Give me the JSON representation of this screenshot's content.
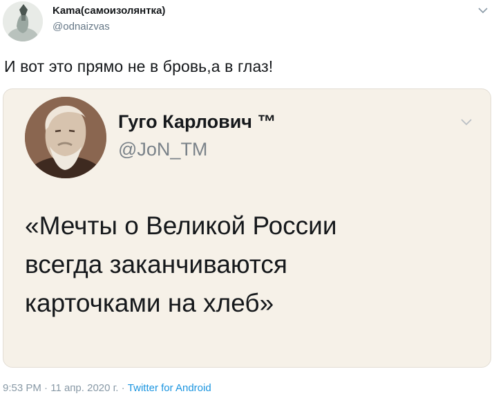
{
  "tweet": {
    "author": {
      "display_name": "Kama(самоизолянтка)",
      "handle": "@odnaizvas"
    },
    "text": "И вот это прямо не в бровь,а в глаз!",
    "quoted": {
      "display_name": "Гуго Карлович ™",
      "handle": "@JoN_TM",
      "lines": [
        "«Мечты о Великой России",
        "всегда заканчиваются",
        "карточками на хлеб»"
      ]
    },
    "meta": {
      "time": "9:53 PM",
      "separator": "·",
      "date": "11 апр. 2020 г.",
      "source": "Twitter for Android"
    }
  },
  "icons": {
    "menu": "chevron-down-icon"
  },
  "colors": {
    "card_bg": "#f6f1e8",
    "link": "#1b95e0",
    "secondary_text": "#657786"
  }
}
